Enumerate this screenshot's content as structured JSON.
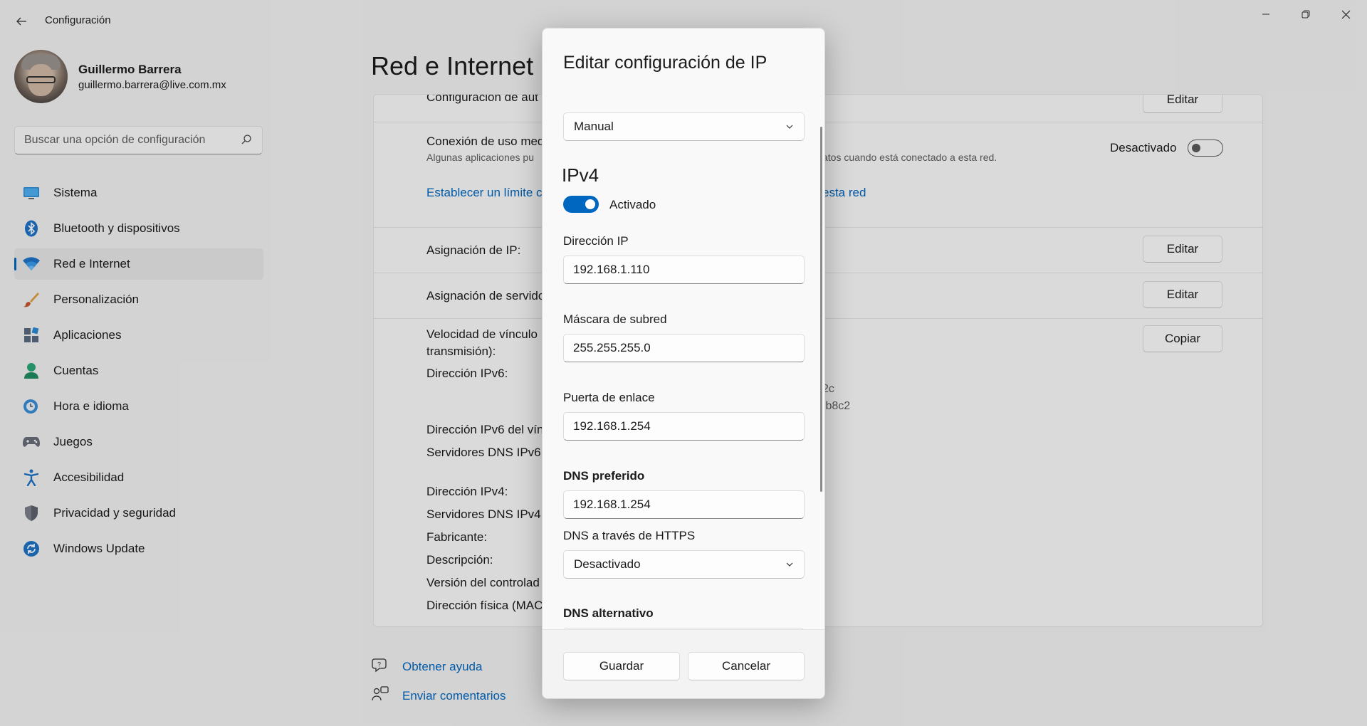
{
  "window": {
    "title": "Configuración",
    "back_icon": "arrow-left-icon",
    "controls": [
      "minimize-icon",
      "restore-icon",
      "close-icon"
    ]
  },
  "profile": {
    "name": "Guillermo Barrera",
    "email": "guillermo.barrera@live.com.mx"
  },
  "search": {
    "placeholder": "Buscar una opción de configuración"
  },
  "nav": {
    "items": [
      {
        "label": "Sistema",
        "icon": "monitor-icon"
      },
      {
        "label": "Bluetooth y dispositivos",
        "icon": "bluetooth-icon"
      },
      {
        "label": "Red e Internet",
        "icon": "wifi-icon",
        "active": true
      },
      {
        "label": "Personalización",
        "icon": "brush-icon"
      },
      {
        "label": "Aplicaciones",
        "icon": "apps-icon"
      },
      {
        "label": "Cuentas",
        "icon": "person-icon"
      },
      {
        "label": "Hora e idioma",
        "icon": "clock-globe-icon"
      },
      {
        "label": "Juegos",
        "icon": "gamepad-icon"
      },
      {
        "label": "Accesibilidad",
        "icon": "accessibility-icon"
      },
      {
        "label": "Privacidad y seguridad",
        "icon": "shield-icon"
      },
      {
        "label": "Windows Update",
        "icon": "sync-icon"
      }
    ]
  },
  "main": {
    "title": "Red e Internet",
    "row_auto_config": {
      "label": "Configuración de aut",
      "button": "Editar"
    },
    "row_metered": {
      "label": "Conexión de uso med",
      "description_left": "Algunas aplicaciones pu",
      "description_right": "atos cuando está conectado a esta red.",
      "toggle_label": "Desactivado",
      "link_left": "Establecer un límite c",
      "link_right": "esta red"
    },
    "row_ip_assignment": {
      "label": "Asignación de IP:",
      "button": "Editar"
    },
    "row_dns_assignment": {
      "label": "Asignación de servido",
      "button": "Editar"
    },
    "properties": {
      "link_speed_1": "Velocidad de vínculo",
      "link_speed_2": "transmisión):",
      "copy_button": "Copiar",
      "ipv6": "Dirección IPv6:",
      "ipv6_val_1": "2c",
      "ipv6_val_2": ":b8c2",
      "ipv6_link": "Dirección IPv6 del vín",
      "dns_ipv6": "Servidores DNS IPv6:",
      "ipv4": "Dirección IPv4:",
      "dns_ipv4": "Servidores DNS IPv4:",
      "manufacturer": "Fabricante:",
      "description": "Descripción:",
      "driver_version": "Versión del controlad",
      "mac": "Dirección física (MAC"
    },
    "help": {
      "get_help": "Obtener ayuda",
      "feedback": "Enviar comentarios"
    }
  },
  "dialog": {
    "title": "Editar configuración de IP",
    "mode": "Manual",
    "ipv4_heading": "IPv4",
    "ipv4_toggle_label": "Activado",
    "ip_label": "Dirección IP",
    "ip_value": "192.168.1.110",
    "mask_label": "Máscara de subred",
    "mask_value": "255.255.255.0",
    "gateway_label": "Puerta de enlace",
    "gateway_value": "192.168.1.254",
    "dns_pref_label": "DNS preferido",
    "dns_pref_value": "192.168.1.254",
    "doh_label": "DNS a través de HTTPS",
    "doh_value": "Desactivado",
    "dns_alt_label": "DNS alternativo",
    "save_button": "Guardar",
    "cancel_button": "Cancelar"
  },
  "colors": {
    "accent": "#0067c0",
    "background": "#f3f3f3",
    "card": "#fbfbfb"
  }
}
